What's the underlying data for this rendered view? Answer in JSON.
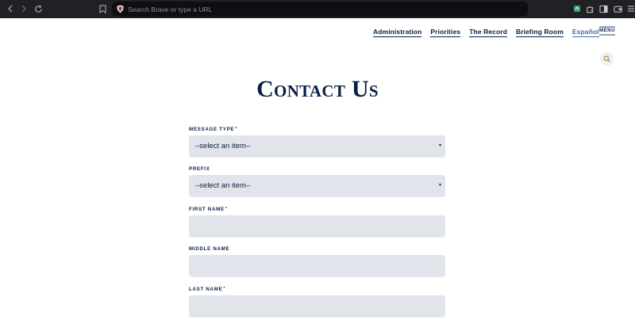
{
  "browser": {
    "url_placeholder": "Search Brave or type a URL"
  },
  "site": {
    "nav": [
      "Administration",
      "Priorities",
      "The Record",
      "Briefing Room",
      "Español"
    ],
    "menu_label": "MENU",
    "page_title": "Contact Us"
  },
  "form": {
    "fields": [
      {
        "label": "MESSAGE TYPE",
        "required": "*",
        "type": "select",
        "value": "–select an item–"
      },
      {
        "label": "PREFIX",
        "required": "",
        "type": "select",
        "value": "–select an item–"
      },
      {
        "label": "FIRST NAME",
        "required": "*",
        "type": "text",
        "value": ""
      },
      {
        "label": "MIDDLE NAME",
        "required": "",
        "type": "text",
        "value": ""
      },
      {
        "label": "LAST NAME",
        "required": "*",
        "type": "text",
        "value": ""
      }
    ]
  },
  "colors": {
    "navy": "#0a1f44",
    "field_bg": "#e1e4ea",
    "link_blue": "#3a6ea5",
    "chrome_bg": "#202124"
  }
}
